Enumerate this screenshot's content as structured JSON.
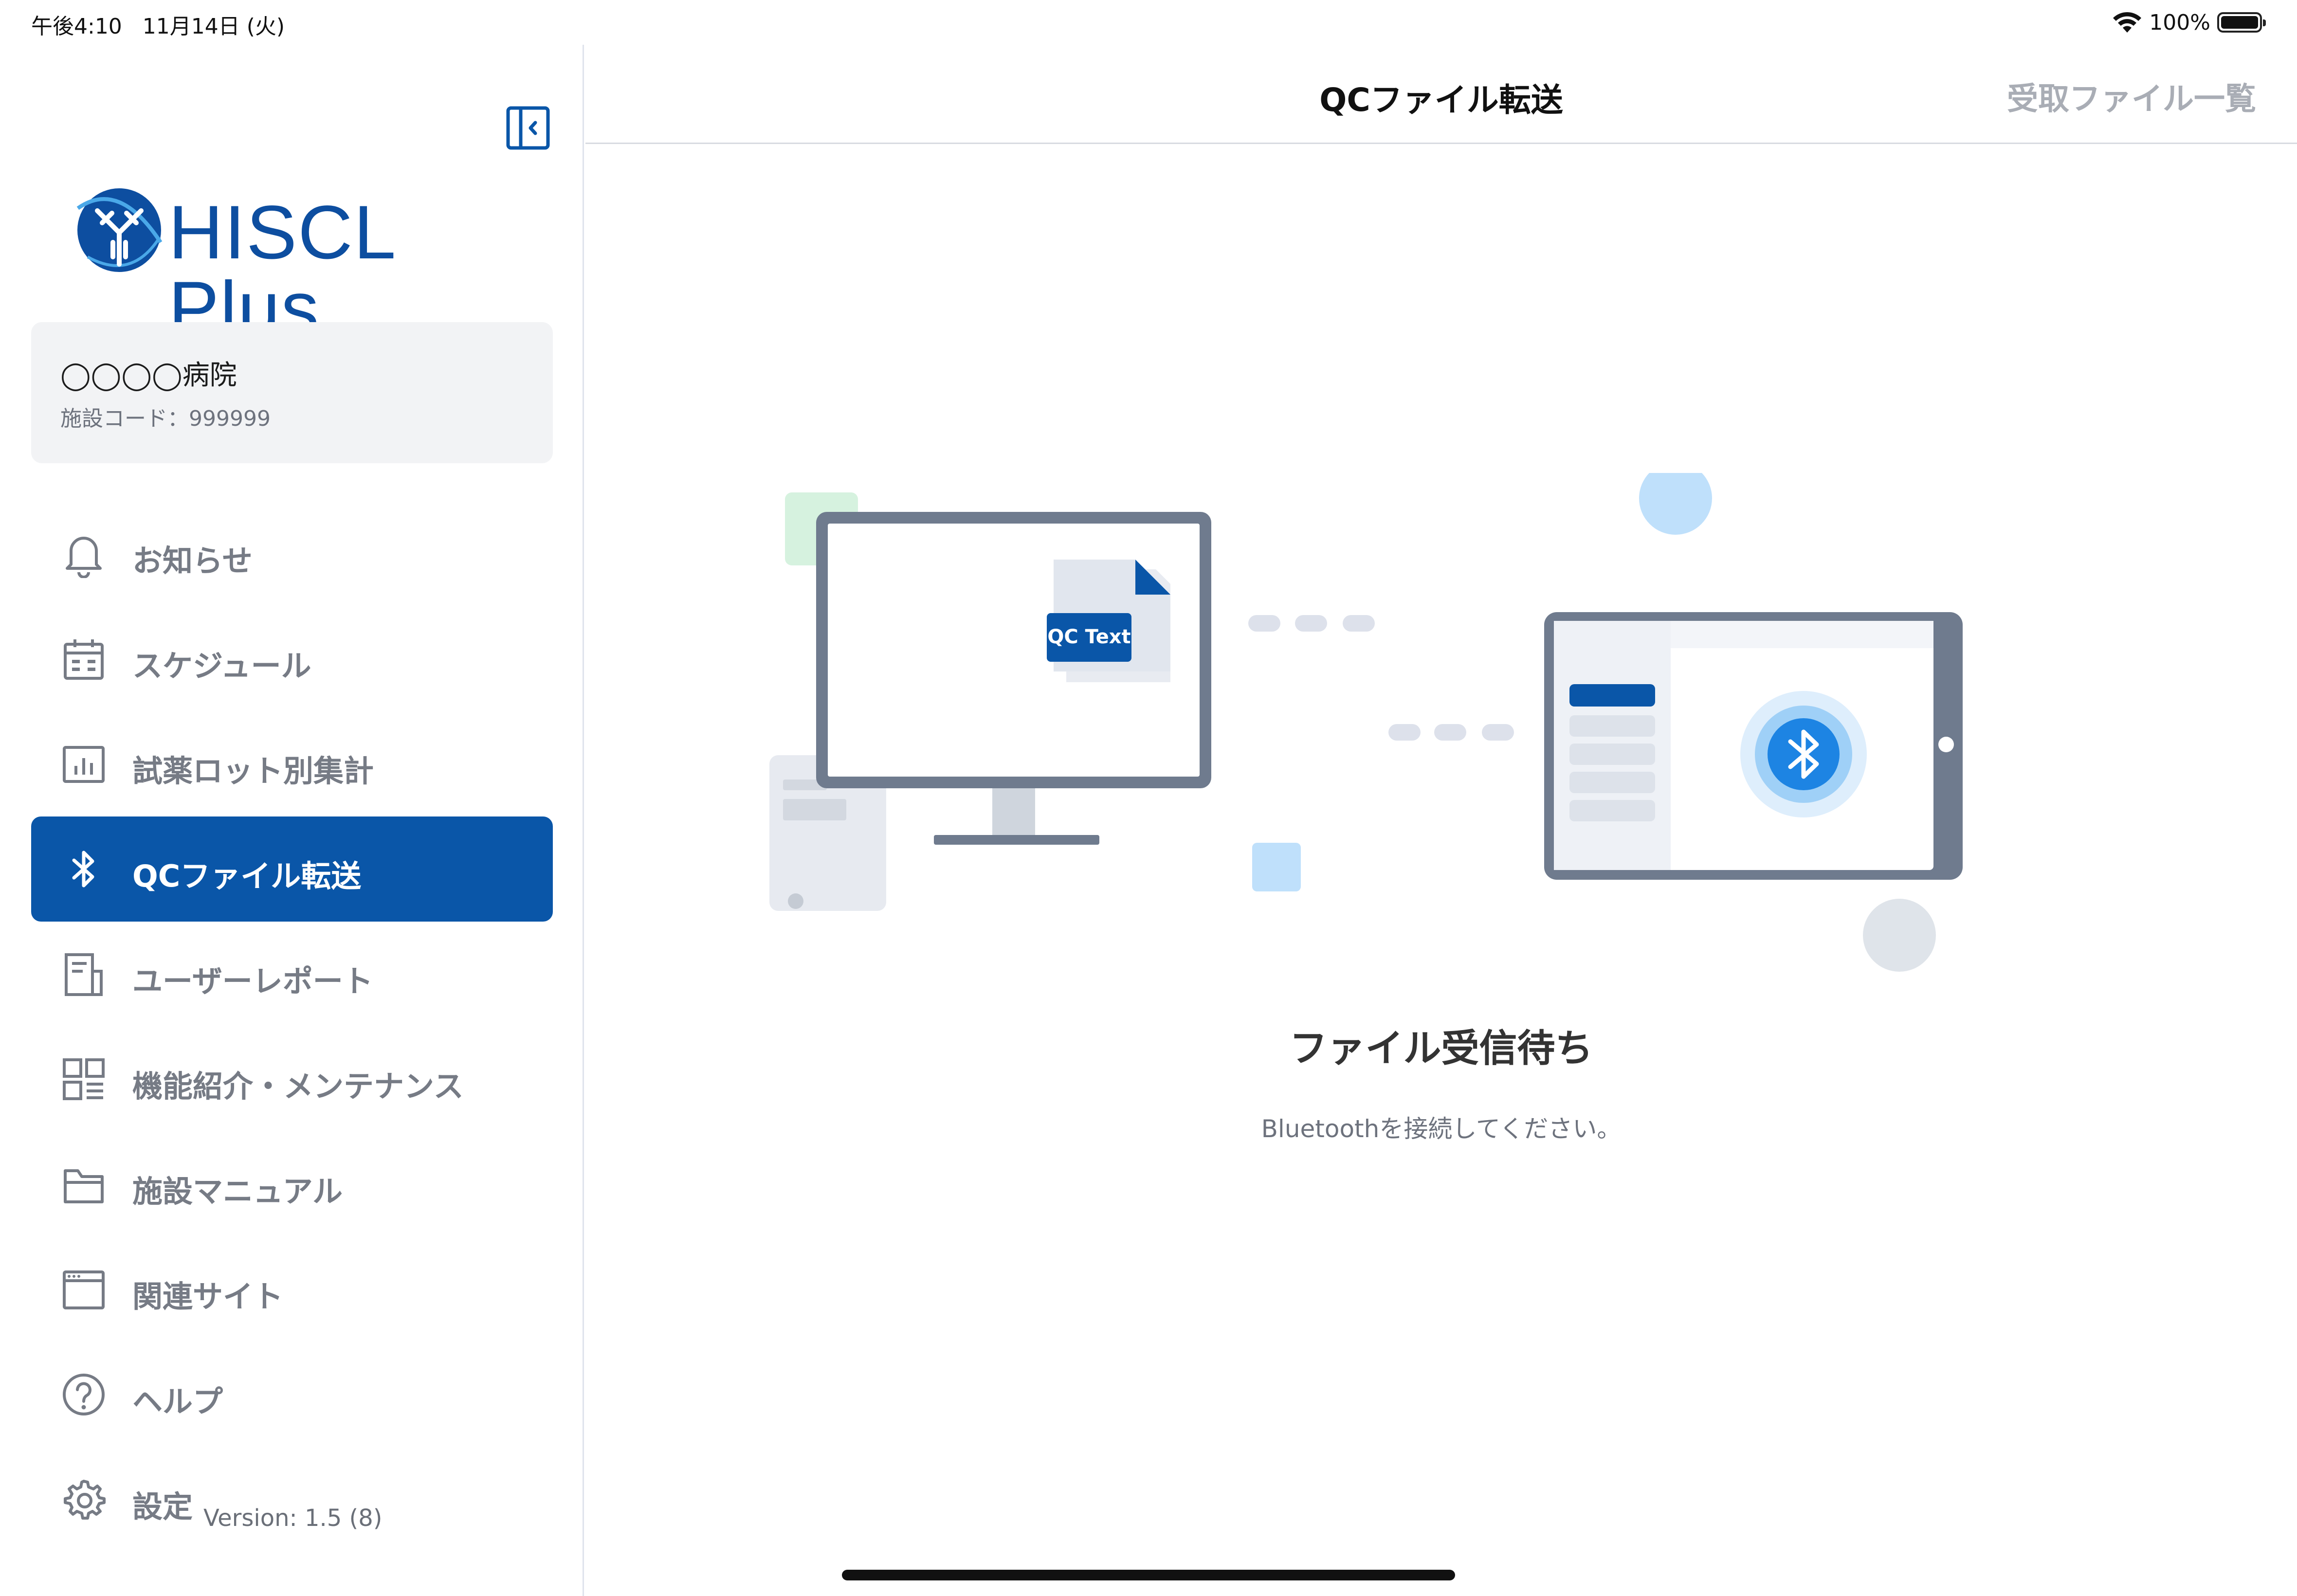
{
  "status_bar": {
    "time_date": "午後4:10   11月14日 (火)",
    "battery": "100%"
  },
  "sidebar": {
    "logo_text": "HISCL Plus",
    "facility": {
      "name": "◯◯◯◯病院",
      "code": "施設コード：999999"
    },
    "items": [
      {
        "label": "お知らせ",
        "icon": "bell-icon"
      },
      {
        "label": "スケジュール",
        "icon": "calendar-icon"
      },
      {
        "label": "試薬ロット別集計",
        "icon": "bar-chart-icon"
      },
      {
        "label": "QCファイル転送",
        "icon": "bluetooth-icon",
        "active": true
      },
      {
        "label": "ユーザーレポート",
        "icon": "report-icon"
      },
      {
        "label": "機能紹介・メンテナンス",
        "icon": "grid-icon"
      },
      {
        "label": "施設マニュアル",
        "icon": "folder-icon"
      },
      {
        "label": "関連サイト",
        "icon": "browser-icon"
      },
      {
        "label": "ヘルプ",
        "icon": "help-icon"
      },
      {
        "label": "設定",
        "icon": "gear-icon"
      }
    ],
    "version": "Version: 1.5 (8)"
  },
  "navbar": {
    "title": "QCファイル転送",
    "right_button": "受取ファイル一覧"
  },
  "illustration": {
    "file_label": "QC Text"
  },
  "content": {
    "status_title": "ファイル受信待ち",
    "status_message": "Bluetoothを接続してください。"
  },
  "colors": {
    "accent": "#0a56a8",
    "inactive_text": "#767b85",
    "disabled_button": "#a9adb5"
  }
}
